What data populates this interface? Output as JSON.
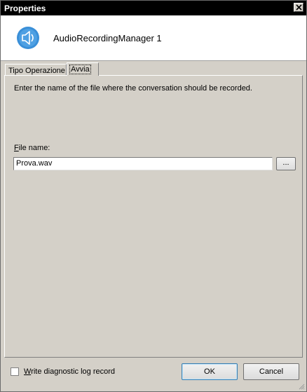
{
  "window": {
    "title": "Properties"
  },
  "header": {
    "title": "AudioRecordingManager 1",
    "icon": "speaker-icon"
  },
  "tabs": [
    {
      "label": "Tipo Operazione",
      "selected": false
    },
    {
      "label": "Avvia",
      "selected": true
    }
  ],
  "panel": {
    "instruction": "Enter the name of the file where the conversation should be recorded.",
    "file_label_mnemonic": "F",
    "file_label_rest": "ile name:",
    "file_value": "Prova.wav",
    "browse_label": "..."
  },
  "footer": {
    "checkbox_mnemonic": "W",
    "checkbox_rest": "rite diagnostic log record",
    "checkbox_checked": false,
    "ok_label": "OK",
    "cancel_label": "Cancel"
  },
  "colors": {
    "icon_blue": "#3a8fd8",
    "titlebar": "#000000",
    "face": "#d4d0c8"
  }
}
